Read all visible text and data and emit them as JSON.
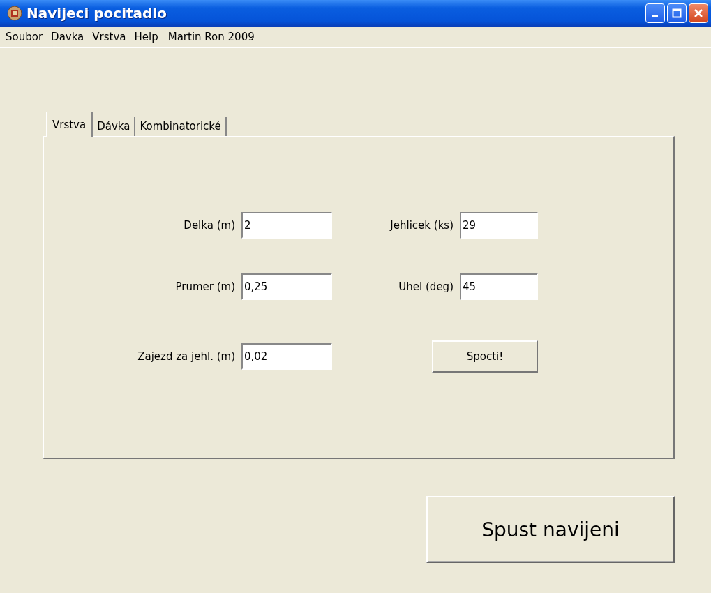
{
  "window": {
    "title": "Navijeci pocitadlo"
  },
  "menu": [
    {
      "label": "Soubor"
    },
    {
      "label": "Davka"
    },
    {
      "label": "Vrstva"
    },
    {
      "label": "Help"
    }
  ],
  "menu_note": "Martin Ron 2009",
  "tabs": [
    {
      "label": "Vrstva",
      "selected": true
    },
    {
      "label": "Dávka",
      "selected": false
    },
    {
      "label": "Kombinatorické",
      "selected": false
    }
  ],
  "form": {
    "rows": [
      {
        "items": [
          {
            "kind": "field",
            "label": "Delka (m)",
            "value": "2"
          },
          {
            "kind": "field",
            "label": "Jehlicek (ks)",
            "value": "29"
          }
        ]
      },
      {
        "items": [
          {
            "kind": "field",
            "label": "Prumer (m)",
            "value": "0,25"
          },
          {
            "kind": "field",
            "label": "Uhel (deg)",
            "value": "45"
          }
        ]
      },
      {
        "items": [
          {
            "kind": "field",
            "label": "Zajezd za jehl. (m)",
            "value": "0,02"
          },
          {
            "kind": "button",
            "label": "Spocti!"
          }
        ]
      }
    ]
  },
  "main_button": {
    "label": "Spust navijeni"
  }
}
